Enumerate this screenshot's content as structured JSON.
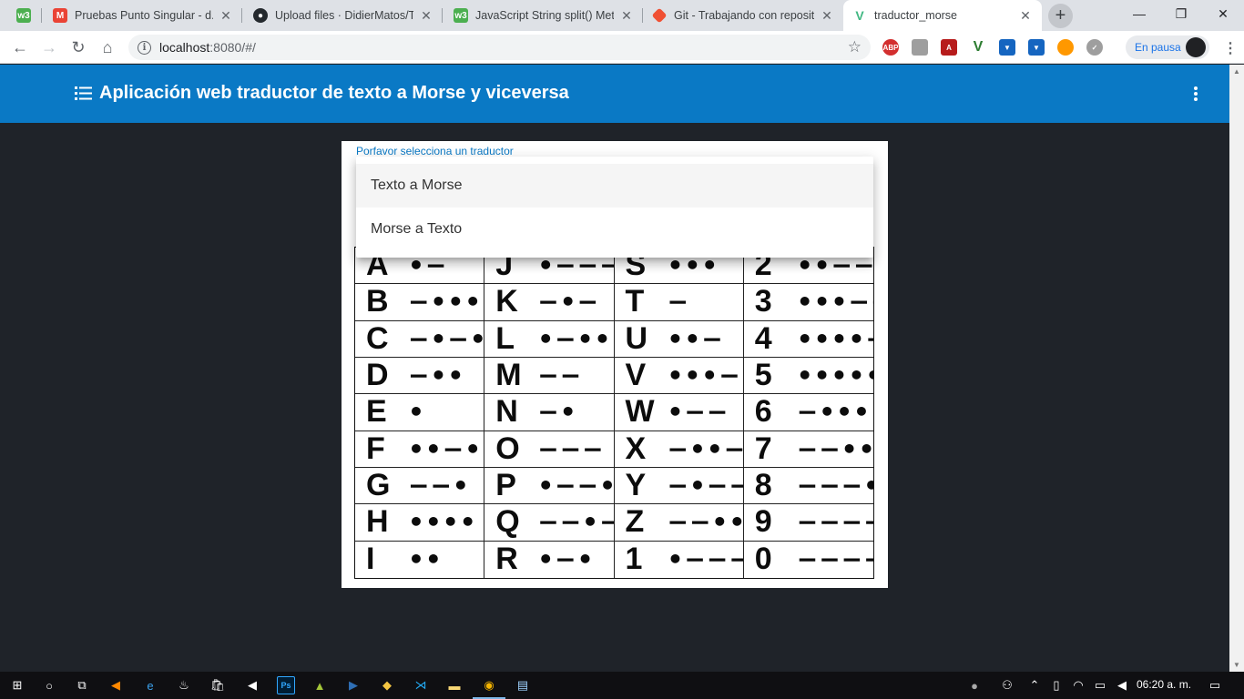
{
  "browser": {
    "tabs": [
      {
        "title": "",
        "favicon": "w3schools-icon",
        "color": "#4caf50",
        "letter": "w3"
      },
      {
        "title": "Pruebas Punto Singular - d.m",
        "favicon": "gmail-icon",
        "color": "#ea4335",
        "letter": "M"
      },
      {
        "title": "Upload files · DidierMatos/Tr",
        "favicon": "github-icon",
        "color": "#24292e",
        "letter": "G"
      },
      {
        "title": "JavaScript String split() Meth",
        "favicon": "w3schools-icon",
        "color": "#4caf50",
        "letter": "w3"
      },
      {
        "title": "Git - Trabajando con reposito",
        "favicon": "git-icon",
        "color": "#f05033",
        "letter": "◆"
      },
      {
        "title": "traductor_morse",
        "favicon": "vue-icon",
        "color": "#42b883",
        "letter": "V"
      }
    ],
    "address": {
      "host": "localhost",
      "path": ":8080/#/"
    },
    "profile_status": "En pausa"
  },
  "app": {
    "title": "Aplicación web traductor de texto a Morse y viceversa",
    "select_label": "Porfavor selecciona un traductor",
    "options": [
      "Texto a Morse",
      "Morse a Texto"
    ]
  },
  "morse_table": [
    {
      "char": "A",
      "code": "•−"
    },
    {
      "char": "J",
      "code": "•−−−"
    },
    {
      "char": "S",
      "code": "•••"
    },
    {
      "char": "2",
      "code": "••−−−"
    },
    {
      "char": "B",
      "code": "−•••"
    },
    {
      "char": "K",
      "code": "−•−"
    },
    {
      "char": "T",
      "code": "−"
    },
    {
      "char": "3",
      "code": "•••−−"
    },
    {
      "char": "C",
      "code": "−•−•"
    },
    {
      "char": "L",
      "code": "•−••"
    },
    {
      "char": "U",
      "code": "••−"
    },
    {
      "char": "4",
      "code": "••••−"
    },
    {
      "char": "D",
      "code": "−••"
    },
    {
      "char": "M",
      "code": "−−"
    },
    {
      "char": "V",
      "code": "•••−"
    },
    {
      "char": "5",
      "code": "•••••"
    },
    {
      "char": "E",
      "code": "•"
    },
    {
      "char": "N",
      "code": "−•"
    },
    {
      "char": "W",
      "code": "•−−"
    },
    {
      "char": "6",
      "code": "−••••"
    },
    {
      "char": "F",
      "code": "••−•"
    },
    {
      "char": "O",
      "code": "−−−"
    },
    {
      "char": "X",
      "code": "−••−"
    },
    {
      "char": "7",
      "code": "−−•••"
    },
    {
      "char": "G",
      "code": "−−•"
    },
    {
      "char": "P",
      "code": "•−−•"
    },
    {
      "char": "Y",
      "code": "−•−−"
    },
    {
      "char": "8",
      "code": "−−−••"
    },
    {
      "char": "H",
      "code": "••••"
    },
    {
      "char": "Q",
      "code": "−−•−"
    },
    {
      "char": "Z",
      "code": "−−••"
    },
    {
      "char": "9",
      "code": "−−−−•"
    },
    {
      "char": "I",
      "code": "••"
    },
    {
      "char": "R",
      "code": "•−•"
    },
    {
      "char": "1",
      "code": "•−−−−"
    },
    {
      "char": "0",
      "code": "−−−−−"
    }
  ],
  "taskbar": {
    "clock": "06:20 a. m."
  },
  "colors": {
    "appbar": "#0a79c5",
    "page_bg": "#1f2329"
  }
}
